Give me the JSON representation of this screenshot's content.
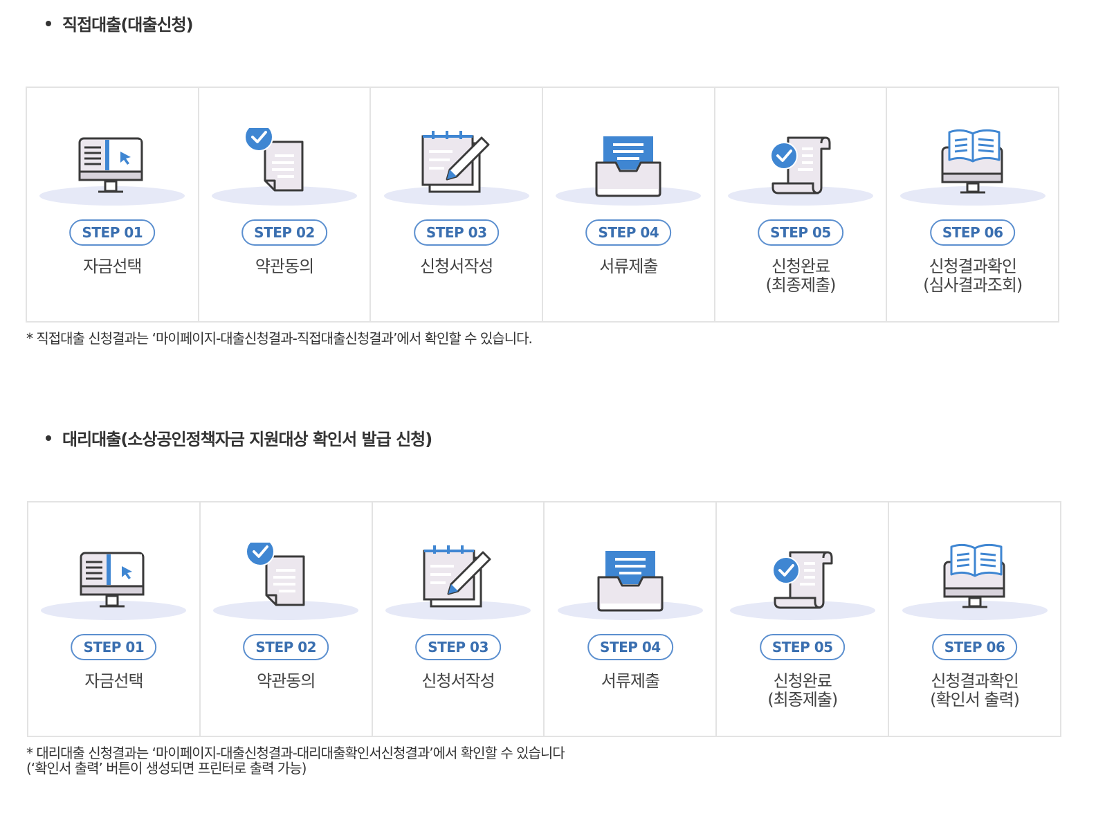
{
  "direct": {
    "title": "직접대출(대출신청)",
    "steps": [
      {
        "badge": "STEP 01",
        "label_line1": "자금선택",
        "label_line2": "",
        "icon": "monitor-cursor-icon"
      },
      {
        "badge": "STEP 02",
        "label_line1": "약관동의",
        "label_line2": "",
        "icon": "document-check-icon"
      },
      {
        "badge": "STEP 03",
        "label_line1": "신청서작성",
        "label_line2": "",
        "icon": "notepad-pencil-icon"
      },
      {
        "badge": "STEP 04",
        "label_line1": "서류제출",
        "label_line2": "",
        "icon": "inbox-tray-icon"
      },
      {
        "badge": "STEP 05",
        "label_line1": "신청완료",
        "label_line2": "(최종제출)",
        "icon": "scroll-check-icon"
      },
      {
        "badge": "STEP 06",
        "label_line1": "신청결과확인",
        "label_line2": "(심사결과조회)",
        "icon": "monitor-book-icon"
      }
    ],
    "note_line1": "* 직접대출 신청결과는 ‘마이페이지-대출신청결과-직접대출신청결과’에서 확인할 수 있습니다.",
    "note_line2": ""
  },
  "proxy": {
    "title": "대리대출(소상공인정책자금 지원대상 확인서 발급 신청)",
    "steps": [
      {
        "badge": "STEP 01",
        "label_line1": "자금선택",
        "label_line2": "",
        "icon": "monitor-cursor-icon"
      },
      {
        "badge": "STEP 02",
        "label_line1": "약관동의",
        "label_line2": "",
        "icon": "document-check-icon"
      },
      {
        "badge": "STEP 03",
        "label_line1": "신청서작성",
        "label_line2": "",
        "icon": "notepad-pencil-icon"
      },
      {
        "badge": "STEP 04",
        "label_line1": "서류제출",
        "label_line2": "",
        "icon": "inbox-tray-icon"
      },
      {
        "badge": "STEP 05",
        "label_line1": "신청완료",
        "label_line2": "(최종제출)",
        "icon": "scroll-check-icon"
      },
      {
        "badge": "STEP 06",
        "label_line1": "신청결과확인",
        "label_line2": "(확인서 출력)",
        "icon": "monitor-book-icon"
      }
    ],
    "note_line1": "* 대리대출 신청결과는 ‘마이페이지-대출신청결과-대리대출확인서신청결과’에서 확인할 수 있습니다",
    "note_line2": "(‘확인서 출력’ 버튼이 생성되면 프린터로 출력 가능)"
  },
  "colors": {
    "accent_blue": "#3f86d2",
    "badge_text": "#3a6fb0",
    "icon_outline": "#3a3a3a",
    "icon_fill": "#ece7ee",
    "shadow": "#e6e9f7",
    "border": "#e3e3e3"
  }
}
